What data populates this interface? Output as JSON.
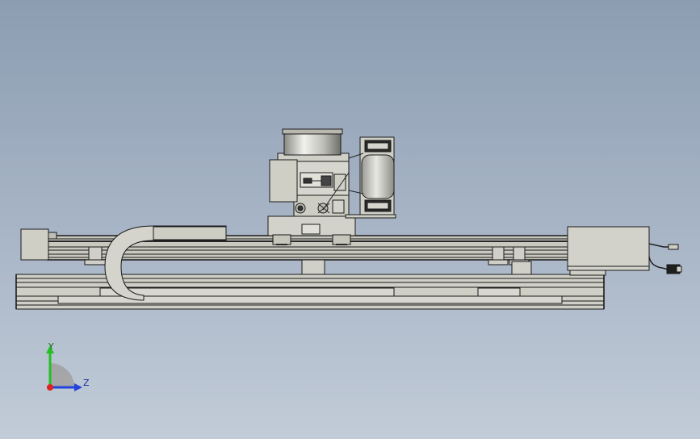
{
  "viewport": {
    "background_top": "#8c9db2",
    "background_bottom": "#c2ccd8"
  },
  "triad": {
    "y_label": "Y",
    "z_label": "Z",
    "y_color": "#22c022",
    "z_color": "#2244dd",
    "x_color": "#dd2222"
  },
  "model": {
    "body_color": "#d4d4cc",
    "edge_color": "#1a1a1a",
    "rail_color": "#c9c9c0",
    "dark_accent": "#2a2a2a"
  }
}
